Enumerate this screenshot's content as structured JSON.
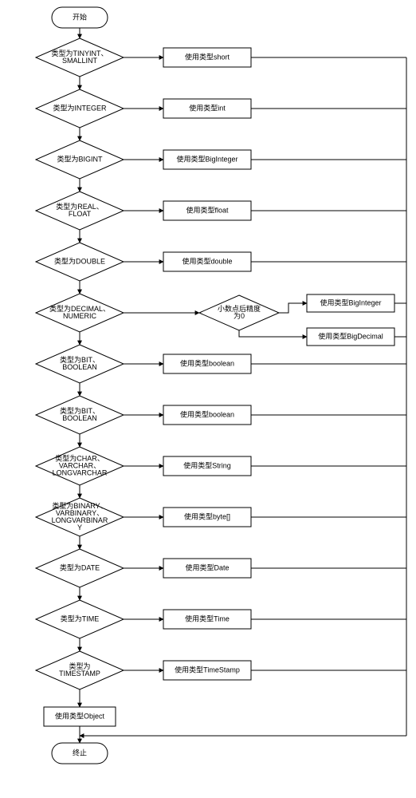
{
  "flowchart": {
    "start": "开始",
    "end": "终止",
    "decisions": [
      {
        "cond": [
          "类型为TINYINT、",
          "SMALLINT"
        ],
        "action": "使用类型short"
      },
      {
        "cond": [
          "类型为INTEGER"
        ],
        "action": "使用类型int"
      },
      {
        "cond": [
          "类型为BIGINT"
        ],
        "action": "使用类型BigInteger"
      },
      {
        "cond": [
          "类型为REAL、",
          "FLOAT"
        ],
        "action": "使用类型float"
      },
      {
        "cond": [
          "类型为DOUBLE"
        ],
        "action": "使用类型double"
      },
      {
        "cond": [
          "类型为DECIMAL、",
          "NUMERIC"
        ],
        "action": "",
        "sub_decision": {
          "cond": [
            "小数点后精度",
            "为0"
          ],
          "yes": "使用类型BigInteger",
          "no": "使用类型BigDecimal"
        }
      },
      {
        "cond": [
          "类型为BIT、",
          "BOOLEAN"
        ],
        "action": "使用类型boolean"
      },
      {
        "cond": [
          "类型为BIT、",
          "BOOLEAN"
        ],
        "action": "使用类型boolean"
      },
      {
        "cond": [
          "类型为CHAR、",
          "VARCHAR、",
          "LONGVARCHAR"
        ],
        "action": "使用类型String"
      },
      {
        "cond": [
          "类型为BINARY、",
          "VARBINARY、",
          "LONGVARBINAR",
          "Y"
        ],
        "action": "使用类型byte[]"
      },
      {
        "cond": [
          "类型为DATE"
        ],
        "action": "使用类型Date"
      },
      {
        "cond": [
          "类型为TIME"
        ],
        "action": "使用类型Time"
      },
      {
        "cond": [
          "类型为",
          "TIMESTAMP"
        ],
        "action": "使用类型TimeStamp"
      }
    ],
    "fallback": "使用类型Object"
  }
}
